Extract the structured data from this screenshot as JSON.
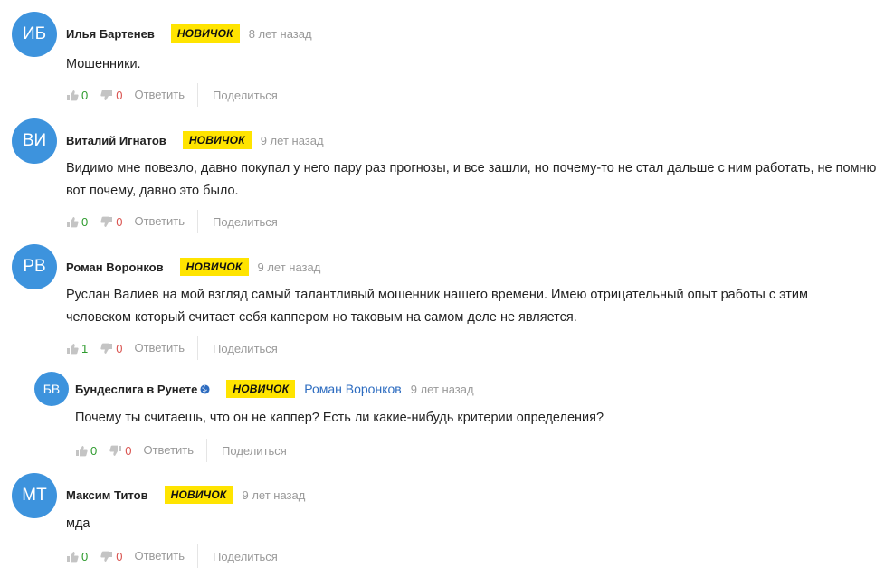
{
  "comments": [
    {
      "initials": "ИБ",
      "author": "Илья Бартенев",
      "badge": "НОВИЧОК",
      "time": "8 лет назад",
      "text": "Мошенники.",
      "likes": "0",
      "dislikes": "0",
      "reply_label": "Ответить",
      "share_label": "Поделиться"
    },
    {
      "initials": "ВИ",
      "author": "Виталий Игнатов",
      "badge": "НОВИЧОК",
      "time": "9 лет назад",
      "text": "Видимо мне повезло, давно покупал у него пару раз прогнозы, и все зашли, но почему-то не стал дальше с ним работать, не помню вот почему, давно это было.",
      "likes": "0",
      "dislikes": "0",
      "reply_label": "Ответить",
      "share_label": "Поделиться"
    },
    {
      "initials": "РВ",
      "author": "Роман Воронков",
      "badge": "НОВИЧОК",
      "time": "9 лет назад",
      "text": "Руслан Валиев на мой взгляд самый талантливый мошенник нашего времени. Имею отрицательный опыт работы с этим человеком который считает себя каппером но таковым на самом деле не является.",
      "likes": "1",
      "dislikes": "0",
      "reply_label": "Ответить",
      "share_label": "Поделиться"
    },
    {
      "initials": "БВ",
      "author": "Бундеслига в Рунете",
      "badge": "НОВИЧОК",
      "reply_to": "Роман Воронков",
      "time": "9 лет назад",
      "text": "Почему ты считаешь, что он не каппер? Есть ли какие-нибудь критерии определения?",
      "likes": "0",
      "dislikes": "0",
      "reply_label": "Ответить",
      "share_label": "Поделиться"
    },
    {
      "initials": "МТ",
      "author": "Максим Титов",
      "badge": "НОВИЧОК",
      "time": "9 лет назад",
      "text": "мда",
      "likes": "0",
      "dislikes": "0",
      "reply_label": "Ответить",
      "share_label": "Поделиться"
    }
  ],
  "colors": {
    "avatar": "#3d93dd",
    "badge": "#ffe400",
    "like": "#2e9b2e",
    "dislike": "#d9534f",
    "link": "#2d6cc0"
  },
  "icons": {
    "like": "thumbs-up-icon",
    "dislike": "thumbs-down-icon",
    "verified": "globe-icon"
  }
}
